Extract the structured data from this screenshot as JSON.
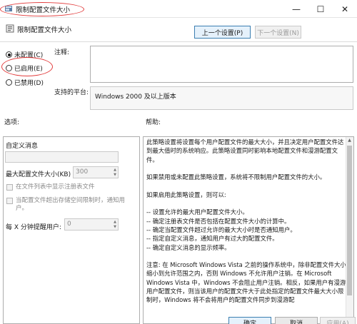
{
  "window": {
    "title": "限制配置文件大小",
    "controls": {
      "minimize": "—",
      "maximize": "☐",
      "close": "✕"
    }
  },
  "header": {
    "policy_name": "限制配置文件大小",
    "prev_button": "上一个设置(P)",
    "next_button": "下一个设置(N)"
  },
  "state": {
    "options": [
      {
        "label": "未配置(C)",
        "selected": true
      },
      {
        "label": "已启用(E)",
        "selected": false
      },
      {
        "label": "已禁用(D)",
        "selected": false
      }
    ]
  },
  "comment": {
    "label": "注释:",
    "value": ""
  },
  "support": {
    "label": "支持的平台:",
    "value": "Windows 2000 及以上版本"
  },
  "options_panel": {
    "label": "选项:",
    "custom_message_label": "自定义消息",
    "custom_message_value": "",
    "max_size_label": "最大配置文件大小(KB)",
    "max_size_value": "300",
    "show_registry_label": "在文件列表中显示注册表文件",
    "notify_label": "当配置文件超出存储空间限制时，通知用户。",
    "remind_label": "每 X 分钟提醒用户:",
    "remind_value": "0"
  },
  "help_panel": {
    "label": "帮助:",
    "paragraphs": [
      "此策略设置将设置每个用户配置文件的最大大小，并且决定用户配置文件达到最大值时的系统响应。此策略设置同时影响本地配置文件和漫游配置文件。",
      "如果禁用或未配置此策略设置，系统将不限制用户配置文件的大小。",
      "如果启用此策略设置，则可以:",
      "-- 设置允许的最大用户配置文件大小。\n-- 确定注册表文件是否包括在配置文件大小的计算中。\n-- 确定当配置文件超过允许的最大大小时是否通知用户。\n-- 指定自定义消息，通知用户有过大的配置文件。\n-- 确定自定义消息的显示频率。",
      "注意: 在 Microsoft Windows Vista 之前的操作系统中，除非配置文件大小缩小到允许范围之内，否则 Windows 不允许用户注销。在 Microsoft Windows Vista 中，Windows 不会阻止用户注销。相反，如果用户有漫游用户配置文件，则当该用户的配置文件大于此处指定的配置文件最大大小限制时，Windows 将不会将用户的配置文件同步到漫游配"
    ]
  },
  "footer": {
    "ok_button": "确定",
    "cancel_button": "取消",
    "apply_button": "应用(A)"
  }
}
